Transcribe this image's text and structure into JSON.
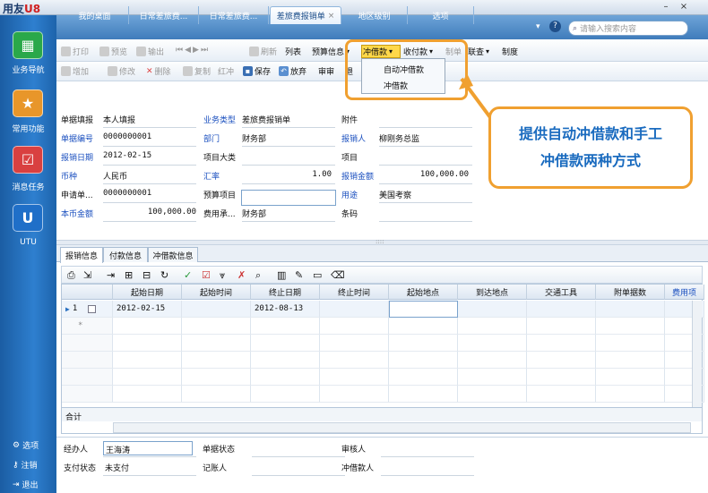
{
  "app": {
    "logo_main": "用友",
    "logo_suffix": "U8"
  },
  "window": {
    "min_glyph": "–",
    "close_glyph": "×"
  },
  "sidebar": {
    "items": [
      {
        "label": "业务导航",
        "icon": "grid-icon"
      },
      {
        "label": "常用功能",
        "icon": "star-icon"
      },
      {
        "label": "消息任务",
        "icon": "task-icon"
      },
      {
        "label": "UTU",
        "icon": "utu-icon"
      }
    ],
    "bottom": [
      {
        "label": "选项",
        "icon": "gear-icon"
      },
      {
        "label": "注销",
        "icon": "key-icon"
      },
      {
        "label": "退出",
        "icon": "exit-icon"
      }
    ]
  },
  "tabs": [
    "我的桌面",
    "日常差旅费...",
    "日常差旅费...",
    "差旅费报销单",
    "地区级别",
    "选项"
  ],
  "active_tab_close": "×",
  "search": {
    "placeholder": "请输入搜索内容"
  },
  "toolbar1": [
    "打印",
    "预览",
    "输出",
    "刷新",
    "列表",
    "预算信息",
    "冲借款",
    "收付款",
    "制单",
    "联查",
    "制度"
  ],
  "toolbar2": [
    "增加",
    "修改",
    "删除",
    "复制",
    "红冲",
    "保存",
    "放弃",
    "审审",
    "退"
  ],
  "dropdown": [
    "自动冲借款",
    "冲借款"
  ],
  "callout": [
    "提供自动冲借款和手工",
    "冲借款两种方式"
  ],
  "form": {
    "rows": [
      [
        {
          "l": "单据填报",
          "v": "本人填报",
          "b": false
        },
        {
          "l": "业务类型",
          "v": "差旅费报销单",
          "b": true
        },
        {
          "l": "附件",
          "v": "",
          "b": false
        }
      ],
      [
        {
          "l": "单据编号",
          "v": "0000000001",
          "b": true
        },
        {
          "l": "部门",
          "v": "财务部",
          "b": true
        },
        {
          "l": "报销人",
          "v": "柳刚务总监",
          "b": true
        }
      ],
      [
        {
          "l": "报销日期",
          "v": "2012-02-15",
          "b": true
        },
        {
          "l": "项目大类",
          "v": "",
          "b": false
        },
        {
          "l": "项目",
          "v": "",
          "b": false
        }
      ],
      [
        {
          "l": "币种",
          "v": "人民币",
          "b": true
        },
        {
          "l": "汇率",
          "v": "1.00",
          "b": true
        },
        {
          "l": "报销金额",
          "v": "100,000.00",
          "b": true
        }
      ],
      [
        {
          "l": "申请单...",
          "v": "0000000001",
          "b": false
        },
        {
          "l": "预算项目",
          "v": "",
          "b": false
        },
        {
          "l": "用途",
          "v": "美国考察",
          "b": true
        }
      ],
      [
        {
          "l": "本币金额",
          "v": "100,000.00",
          "b": true
        },
        {
          "l": "费用承...",
          "v": "财务部",
          "b": false
        },
        {
          "l": "条码",
          "v": "",
          "b": false
        }
      ]
    ]
  },
  "splitter_dots": "::::",
  "subtabs": [
    "报销信息",
    "付款信息",
    "冲借款信息"
  ],
  "grid": {
    "headers": [
      "起始日期",
      "起始时间",
      "终止日期",
      "终止时间",
      "起始地点",
      "到达地点",
      "交通工具",
      "附单据数",
      "费用项"
    ],
    "row1": {
      "num": "1",
      "start_date": "2012-02-15",
      "end_date": "2012-08-13"
    },
    "star": "*",
    "total": "合计"
  },
  "footer": [
    [
      {
        "l": "经办人",
        "v": "王海涛"
      },
      {
        "l": "单据状态",
        "v": ""
      },
      {
        "l": "审核人",
        "v": ""
      }
    ],
    [
      {
        "l": "支付状态",
        "v": "未支付"
      },
      {
        "l": "记账人",
        "v": ""
      },
      {
        "l": "冲借款人",
        "v": ""
      }
    ]
  ]
}
